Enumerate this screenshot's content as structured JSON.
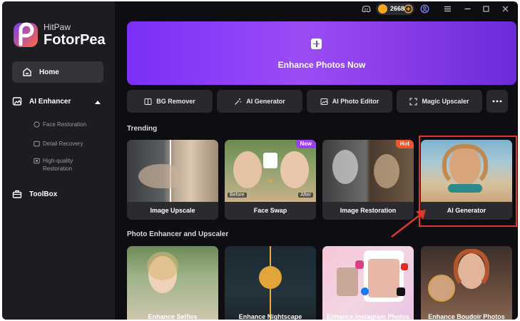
{
  "app": {
    "brand_small": "HitPaw",
    "brand_big": "FotorPea"
  },
  "titlebar": {
    "coins": "2668"
  },
  "sidebar": {
    "home": "Home",
    "ai_enhancer": "AI Enhancer",
    "sub_items": [
      "Face Restoration",
      "Detail Recovery",
      "High-quality",
      "Restoration"
    ],
    "toolbox": "ToolBox"
  },
  "banner": {
    "label": "Enhance Photos Now"
  },
  "tools": [
    "BG Remover",
    "AI Generator",
    "AI Photo Editor",
    "Magic Upscaler"
  ],
  "trending": {
    "title": "Trending",
    "cards": [
      "Image Upscale",
      "Face Swap",
      "Image Restoration",
      "AI Generator"
    ],
    "faceswap_before": "Before",
    "faceswap_after": "After",
    "badge_new": "New",
    "badge_hot": "Hot"
  },
  "enhancer_section": {
    "title": "Photo Enhancer and Upscaler",
    "cards": [
      "Enhance Selfies",
      "Enhance Nightscape",
      "Enhance Instagram Photos",
      "Enhance Boudoir Photos"
    ]
  },
  "colors": {
    "accent": "#8a3be8",
    "highlight": "#e0352b",
    "coin": "#f5a623",
    "badge_new": "#9b3ff5",
    "badge_hot": "#f4532e"
  }
}
